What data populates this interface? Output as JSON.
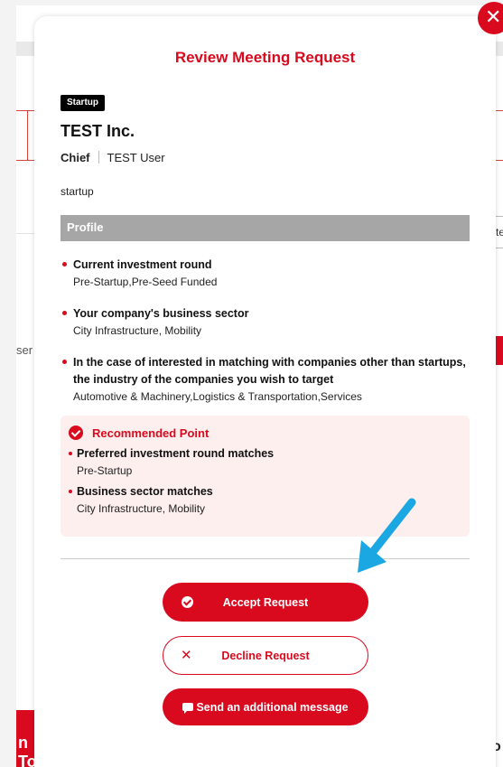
{
  "modal": {
    "title": "Review Meeting Request",
    "badge": "Startup",
    "company_name": "TEST Inc.",
    "person_role": "Chief",
    "person_name": "TEST User",
    "company_description": "startup",
    "profile_header": "Profile",
    "profile_items": [
      {
        "question": "Current investment round",
        "answer": "Pre-Startup,Pre-Seed Funded"
      },
      {
        "question": "Your company's business sector",
        "answer": "City Infrastructure, Mobility"
      },
      {
        "question": "In the case of interested in matching with companies other than startups, the industry of the companies you wish to target",
        "answer": "Automotive & Machinery,Logistics & Transportation,Services"
      }
    ],
    "recommended": {
      "title": "Recommended Point",
      "items": [
        {
          "label": "Preferred investment round matches",
          "value": "Pre-Startup"
        },
        {
          "label": "Business sector matches",
          "value": "City Infrastructure, Mobility"
        }
      ]
    },
    "buttons": {
      "accept": "Accept Request",
      "decline": "Decline Request",
      "message": "Send an additional message"
    }
  },
  "background": {
    "right_box_text": "te",
    "left_text": "ser",
    "bottom_left_text": "n To",
    "bottom_right_text": "o"
  },
  "colors": {
    "accent": "#d9091e",
    "profile_header_bg": "#a6a6a6",
    "recommended_bg": "#fcefee",
    "pointer_arrow": "#1ba7e1"
  },
  "icons": {
    "close": "close-icon",
    "recommended": "check-circle-icon",
    "accept": "check-circle-icon",
    "decline": "x-icon",
    "message": "chat-bubble-icon",
    "pointer": "arrow-pointer-icon"
  }
}
